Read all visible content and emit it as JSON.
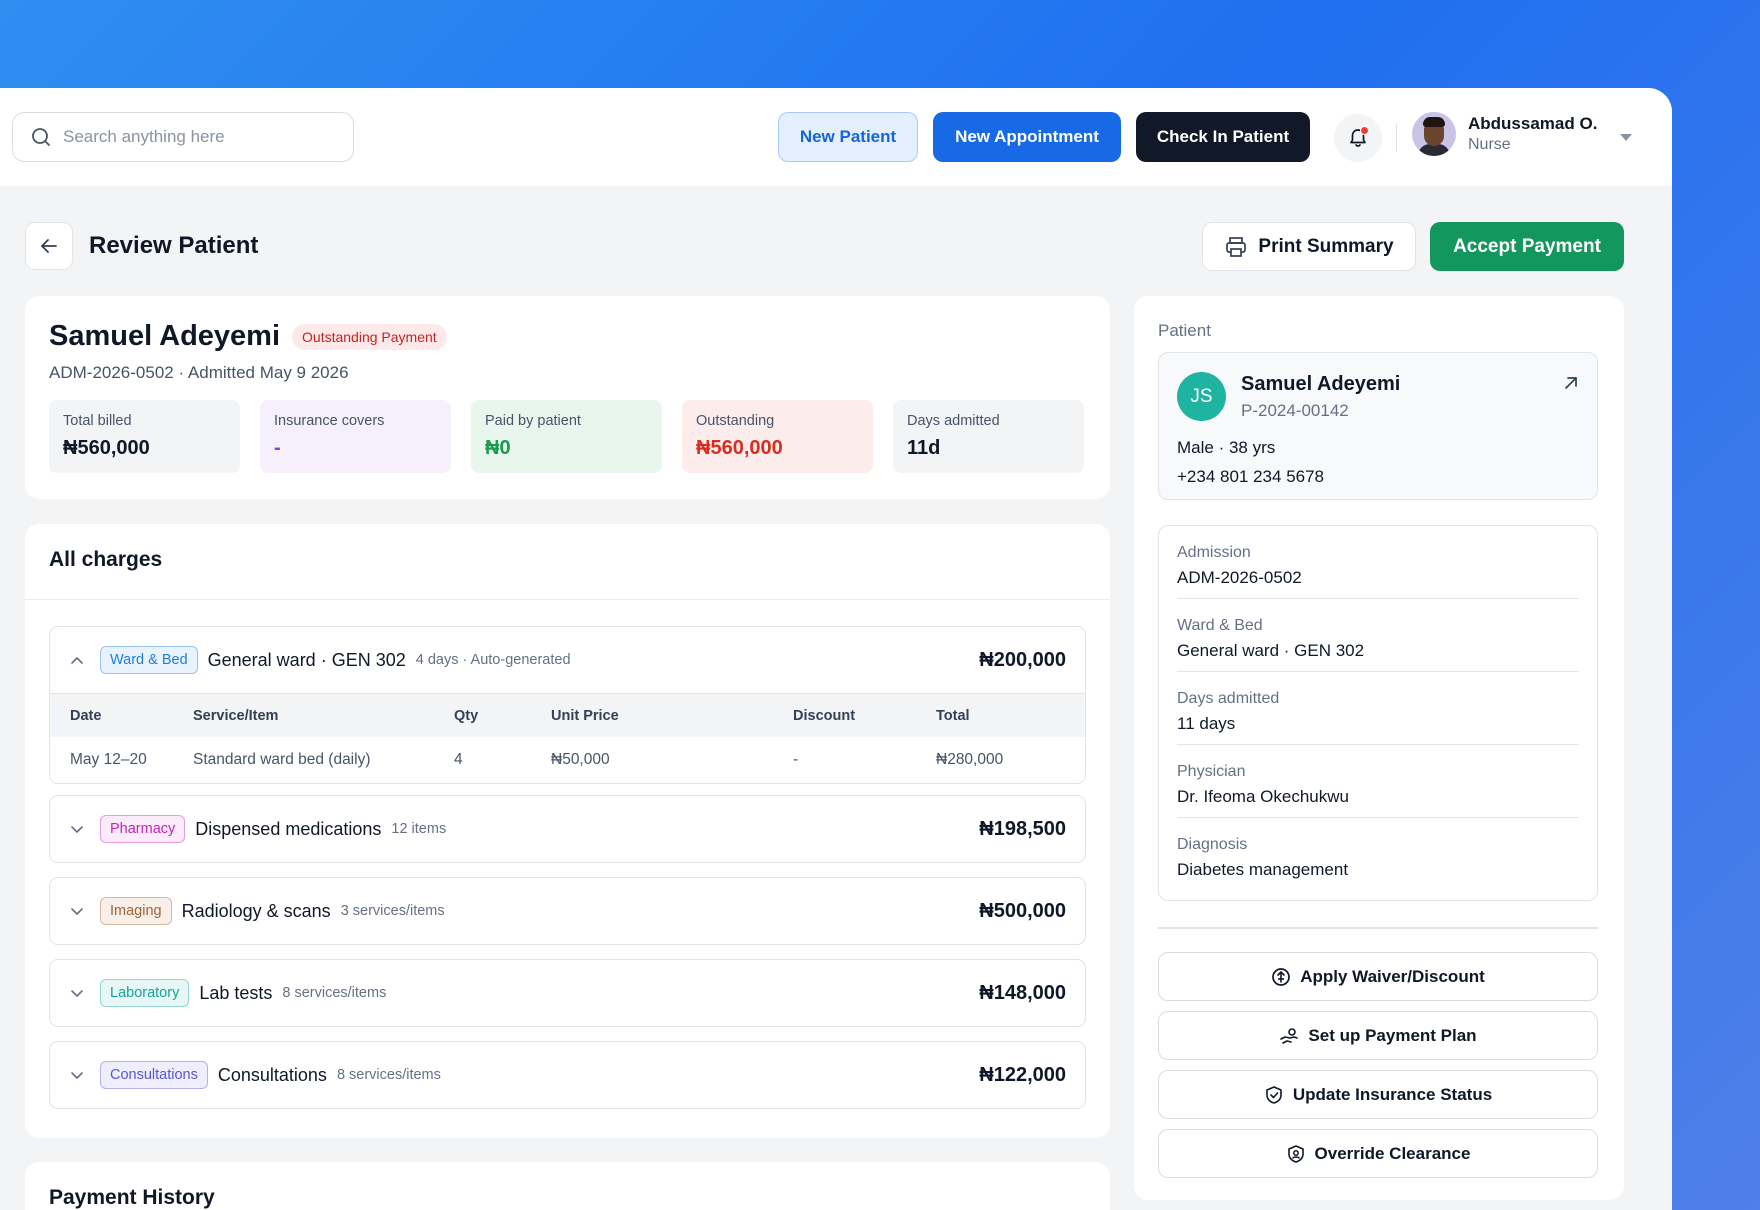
{
  "topbar": {
    "search_placeholder": "Search anything here",
    "new_patient": "New Patient",
    "new_appointment": "New Appointment",
    "check_in": "Check In Patient",
    "user": {
      "name": "Abdussamad O.",
      "role": "Nurse"
    }
  },
  "page": {
    "title": "Review Patient",
    "print_label": "Print Summary",
    "accept_label": "Accept Payment"
  },
  "summary": {
    "name": "Samuel Adeyemi",
    "status_badge": "Outstanding Payment",
    "admission_line": "ADM-2026-0502 · Admitted May 9 2026",
    "stats": [
      {
        "label": "Total billed",
        "value": "₦560,000",
        "bg": "#f3f4f6",
        "color": "#101828"
      },
      {
        "label": "Insurance covers",
        "value": "-",
        "bg": "#f6effc",
        "color": "#8a3ce0"
      },
      {
        "label": "Paid by patient",
        "value": "₦0",
        "bg": "#e9f6ee",
        "color": "#1a9a4f"
      },
      {
        "label": "Outstanding",
        "value": "₦560,000",
        "bg": "#fdecec",
        "color": "#d92d20"
      },
      {
        "label": "Days admitted",
        "value": "11d",
        "bg": "#f3f4f6",
        "color": "#101828"
      }
    ]
  },
  "charges": {
    "title": "All charges",
    "groups": [
      {
        "tag": "Ward & Bed",
        "tag_color": "#1d7fd6",
        "tag_bg": "#e8f3fd",
        "title": "General ward · GEN 302",
        "meta": "4 days · Auto-generated",
        "amount": "₦200,000",
        "expanded": true
      },
      {
        "tag": "Pharmacy",
        "tag_color": "#c026b9",
        "tag_bg": "#fcebfa",
        "title": "Dispensed medications",
        "meta": "12 items",
        "amount": "₦198,500",
        "expanded": false
      },
      {
        "tag": "Imaging",
        "tag_color": "#a0633a",
        "tag_bg": "#f8efe8",
        "title": "Radiology & scans",
        "meta": "3 services/items",
        "amount": "₦500,000",
        "expanded": false
      },
      {
        "tag": "Laboratory",
        "tag_color": "#14a39a",
        "tag_bg": "#e6f7f5",
        "title": "Lab tests",
        "meta": "8 services/items",
        "amount": "₦148,000",
        "expanded": false
      },
      {
        "tag": "Consultations",
        "tag_color": "#5a56d6",
        "tag_bg": "#efeefc",
        "title": "Consultations",
        "meta": "8 services/items",
        "amount": "₦122,000",
        "expanded": false
      }
    ],
    "table_headers": [
      "Date",
      "Service/Item",
      "Qty",
      "Unit Price",
      "Discount",
      "Total"
    ],
    "table_rows": [
      [
        "May 12–20",
        "Standard ward bed (daily)",
        "4",
        "₦50,000",
        "-",
        "₦280,000"
      ]
    ]
  },
  "payment_history": {
    "title": "Payment History"
  },
  "side": {
    "section_label": "Patient",
    "patient": {
      "initials": "JS",
      "name": "Samuel Adeyemi",
      "id": "P-2024-00142",
      "demographics": "Male · 38 yrs",
      "phone": "+234 801 234 5678"
    },
    "details": [
      {
        "label": "Admission",
        "value": "ADM-2026-0502"
      },
      {
        "label": "Ward & Bed",
        "value": "General ward · GEN 302"
      },
      {
        "label": "Days admitted",
        "value": "11 days"
      },
      {
        "label": "Physician",
        "value": "Dr. Ifeoma Okechukwu"
      },
      {
        "label": "Diagnosis",
        "value": "Diabetes management"
      }
    ],
    "actions": [
      {
        "label": "Apply Waiver/Discount",
        "icon": "dollar-circle-icon"
      },
      {
        "label": "Set up Payment Plan",
        "icon": "hand-coins-icon"
      },
      {
        "label": "Update Insurance Status",
        "icon": "shield-check-icon"
      },
      {
        "label": "Override Clearance",
        "icon": "shield-user-icon"
      }
    ]
  }
}
